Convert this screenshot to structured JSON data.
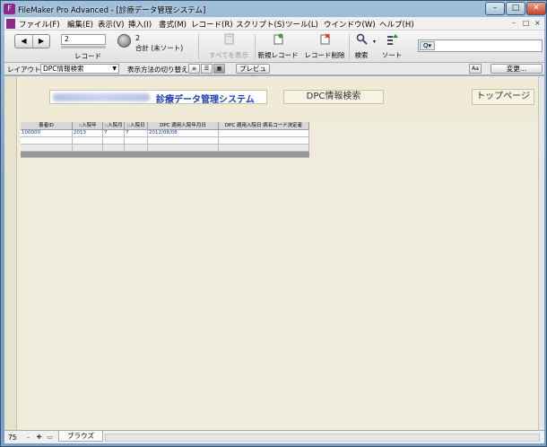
{
  "window": {
    "title": "FileMaker Pro Advanced - [診療データ管理システム]",
    "buttons": {
      "minimize": "–",
      "maximize": "□",
      "close": "✕"
    }
  },
  "menubar": {
    "items": [
      "ファイル(F)",
      "編集(E)",
      "表示(V)",
      "挿入(I)",
      "書式(M)",
      "レコード(R)",
      "スクリプト(S)",
      "ツール(L)",
      "ウインドウ(W)",
      "ヘルプ(H)"
    ],
    "doc_controls": [
      "–",
      "□",
      "×"
    ]
  },
  "toolbar": {
    "record_label": "レコード",
    "record_value": "2",
    "total_count": "2",
    "total_label": "合計 (未ソート)",
    "show_all": "すべてを表示",
    "new_record": "新規レコード",
    "delete_record": "レコード削除",
    "find": "検索",
    "sort": "ソート",
    "search_icon": "magnifier-icon"
  },
  "layoutbar": {
    "layout_label": "レイアウト:",
    "layout_value": "DPC情報検索",
    "view_label": "表示方法の切り替え:",
    "preview": "プレビュー",
    "aa": "Aa",
    "change": "変更..."
  },
  "header": {
    "system_title": "診療データ管理システム",
    "page_label": "DPC情報検索",
    "top_page": "トップページ"
  },
  "table": {
    "columns": [
      "患者ID",
      "::入院年",
      "::入院月",
      "::入院日",
      "DPC 適用入院年月日",
      "DPC 適用入院日 病名コード決定者"
    ],
    "rows": [
      [
        "100000",
        "2013",
        "7",
        "7",
        "2012/08/08",
        ""
      ]
    ]
  },
  "statusbar": {
    "zoom": "75",
    "mode": "ブラウズ"
  },
  "colors": {
    "accent_title": "#1a3fb0",
    "content_bg": "#f0ecdb"
  }
}
